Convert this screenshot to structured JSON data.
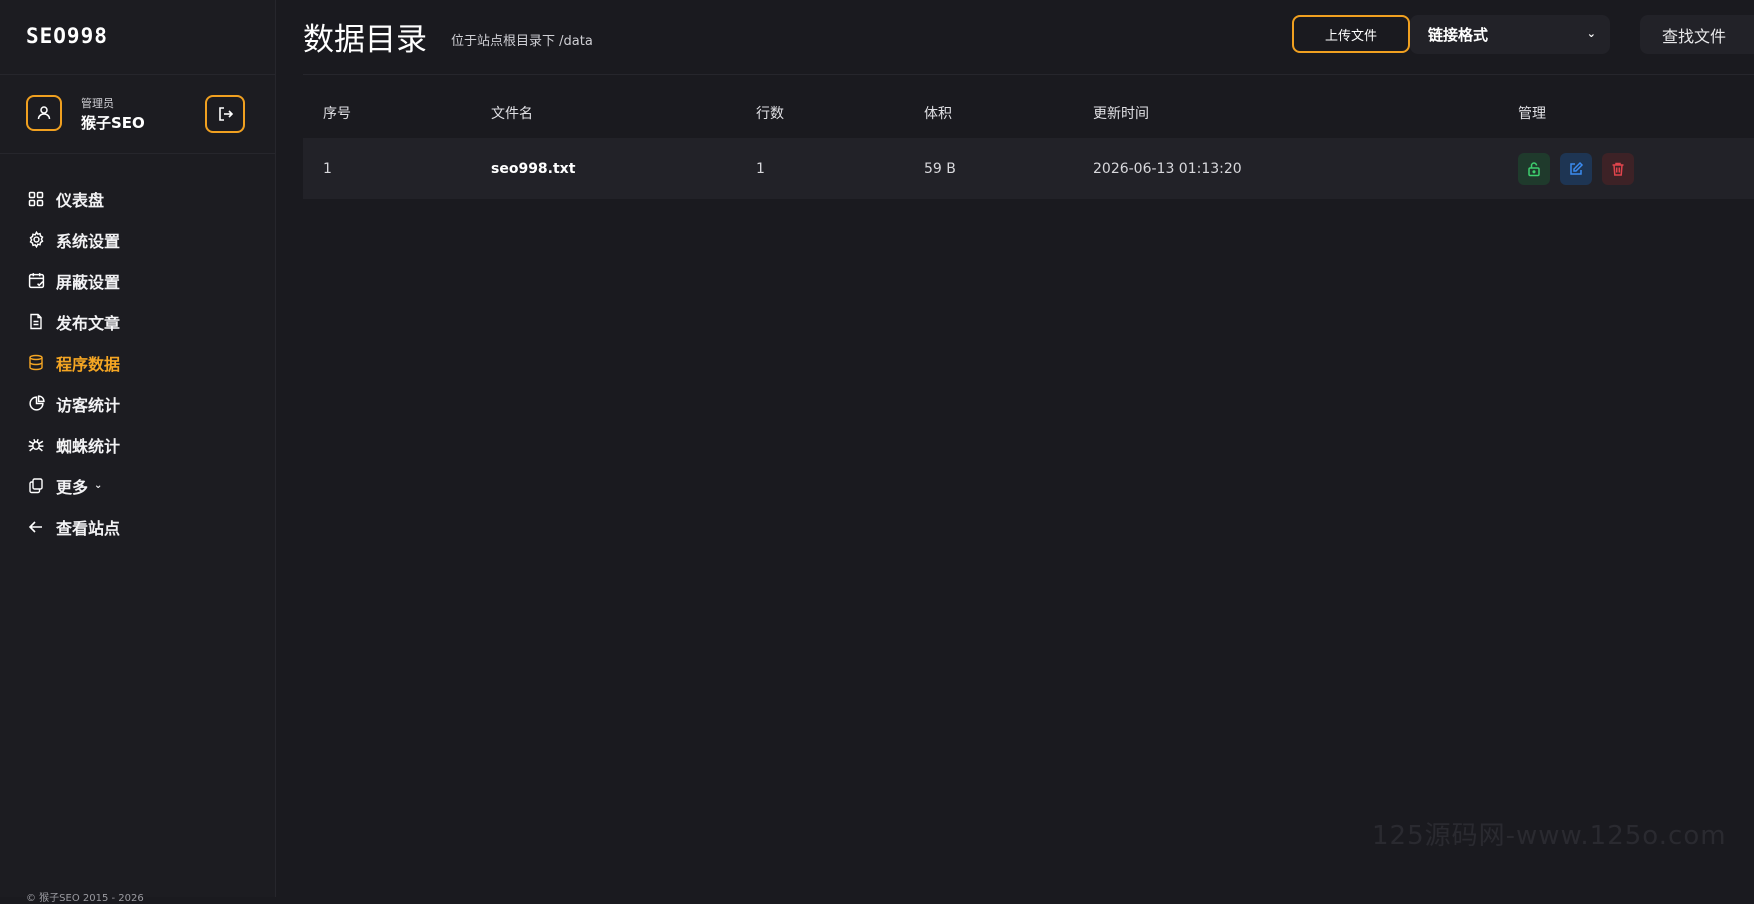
{
  "app": {
    "logo": "SEO998"
  },
  "user": {
    "role": "管理员",
    "name": "猴子SEO"
  },
  "nav": [
    {
      "label": "仪表盘",
      "icon": "grid-icon"
    },
    {
      "label": "系统设置",
      "icon": "gear-icon"
    },
    {
      "label": "屏蔽设置",
      "icon": "calendar-check-icon"
    },
    {
      "label": "发布文章",
      "icon": "document-icon"
    },
    {
      "label": "程序数据",
      "icon": "database-icon",
      "active": true
    },
    {
      "label": "访客统计",
      "icon": "pie-chart-icon"
    },
    {
      "label": "蜘蛛统计",
      "icon": "spider-icon"
    },
    {
      "label": "更多",
      "icon": "copy-icon",
      "has_dropdown": true
    },
    {
      "label": "查看站点",
      "icon": "arrow-left-icon"
    }
  ],
  "footer": {
    "copyright": "© 猴子SEO 2015 - 2026"
  },
  "header": {
    "title": "数据目录",
    "subtitle": "位于站点根目录下 /data",
    "upload_label": "上传文件",
    "link_format_label": "链接格式",
    "find_label": "查找文件"
  },
  "table": {
    "columns": [
      "序号",
      "文件名",
      "行数",
      "体积",
      "更新时间",
      "管理"
    ],
    "rows": [
      {
        "index": "1",
        "filename": "seo998.txt",
        "lines": "1",
        "size": "59 B",
        "updated": "2026-06-13 01:13:20"
      }
    ]
  },
  "watermark": "125源码网-www.125o.com",
  "colors": {
    "accent": "#f5a623",
    "background": "#1a1a1f",
    "lock": "#3ecf6e",
    "edit": "#3b8bf0",
    "delete": "#e0444c"
  }
}
